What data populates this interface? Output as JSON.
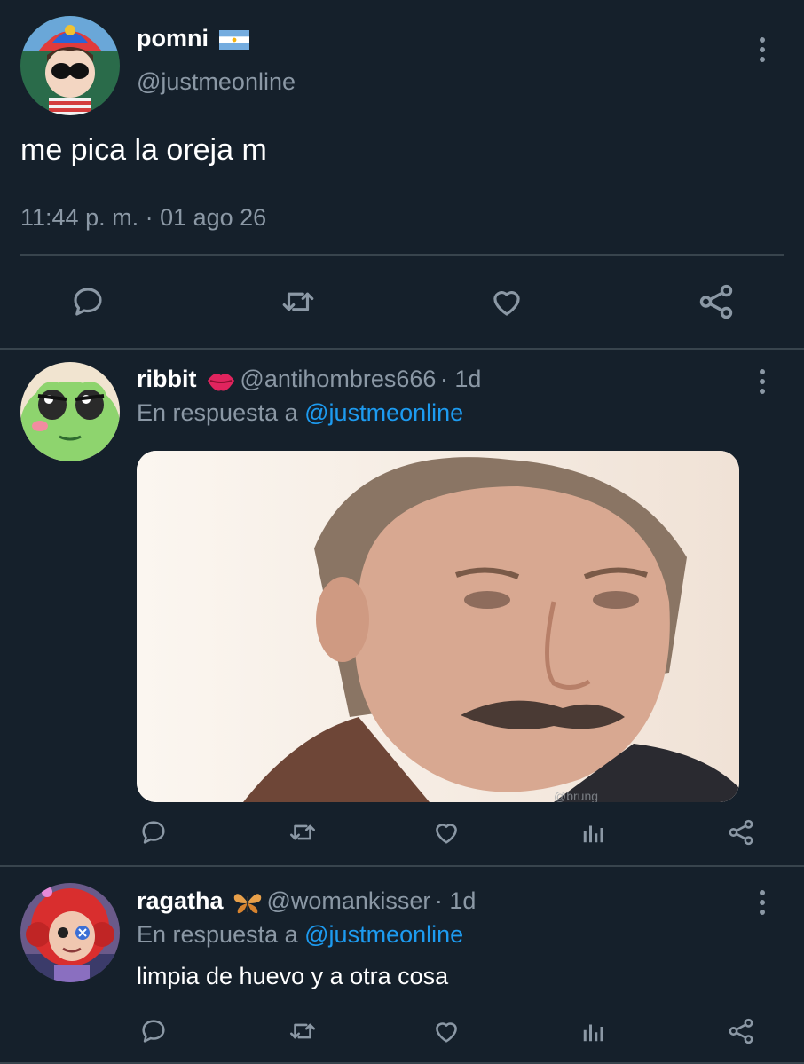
{
  "main_tweet": {
    "display_name": "pomni",
    "name_emoji": "argentina-flag",
    "handle": "@justmeonline",
    "text": "me pica la oreja m",
    "timestamp": "11:44 p. m. · 01 ago 26"
  },
  "replies": [
    {
      "display_name": "ribbit",
      "name_emoji": "lips-emoji",
      "handle": "@antihombres666",
      "time": "· 1d",
      "reply_prefix": "En respuesta a",
      "reply_to": "@justmeonline",
      "media_watermark": "@brung"
    },
    {
      "display_name": "ragatha",
      "name_emoji": "butterfly-emoji",
      "handle": "@womankisser",
      "time": "· 1d",
      "reply_prefix": "En respuesta a",
      "reply_to": "@justmeonline",
      "text": "limpia de huevo y a otra cosa"
    }
  ],
  "icons": [
    "comment-icon",
    "retweet-icon",
    "like-icon",
    "views-icon",
    "share-icon",
    "more-icon"
  ],
  "colors": {
    "background": "#15202b",
    "divider": "#38444d",
    "muted": "#8b98a5",
    "link": "#1d9bf0"
  }
}
